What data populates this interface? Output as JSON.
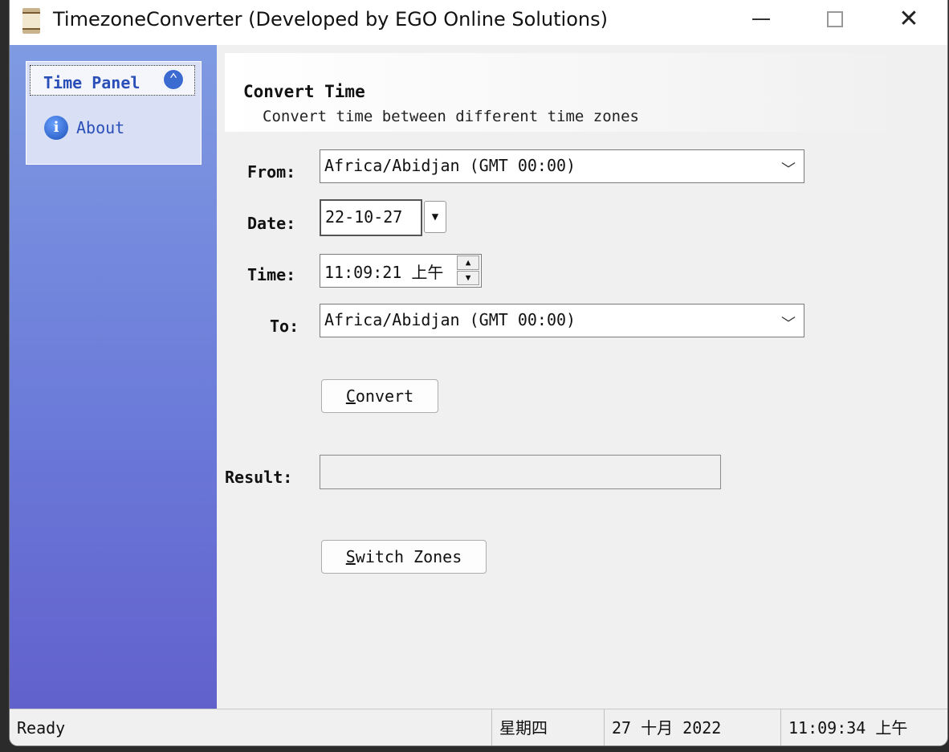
{
  "window": {
    "title": "TimezoneConverter (Developed by EGO Online Solutions)",
    "app_icon": "hourglass-icon",
    "controls": {
      "minimize": "—",
      "maximize": "□",
      "close": "✕"
    }
  },
  "sidebar": {
    "group_title": "Time Panel",
    "collapse_icon": "double-chevron-up-icon",
    "items": [
      {
        "label": "About",
        "icon": "info-icon"
      }
    ]
  },
  "header": {
    "title": "Convert Time",
    "subtitle": "Convert time between different time zones"
  },
  "form": {
    "from_label": "From:",
    "from_value": "Africa/Abidjan (GMT  00:00)",
    "date_label": "Date:",
    "date_value": "22-10-27",
    "time_label": "Time:",
    "time_value": "11:09:21 上午",
    "to_label": "To:",
    "to_value": "Africa/Abidjan (GMT  00:00)",
    "convert_button": {
      "prefix": "C",
      "rest": "onvert"
    },
    "result_label": "Result:",
    "result_value": "",
    "switch_button": {
      "prefix": "S",
      "rest": "witch Zones"
    }
  },
  "status": {
    "ready": "Ready",
    "weekday": "星期四",
    "date": "27 十月 2022",
    "time": "11:09:34 上午"
  },
  "colors": {
    "sidebar_top": "#7f9be2",
    "sidebar_bottom": "#6261cc",
    "panel_text": "#2b4fb8"
  }
}
